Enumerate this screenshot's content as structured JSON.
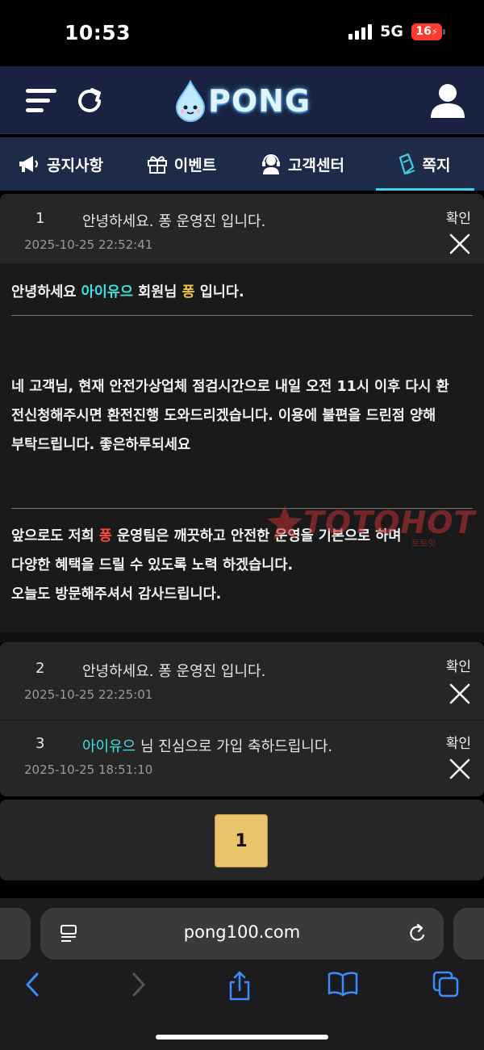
{
  "status_bar": {
    "time": "10:53",
    "network": "5G",
    "battery": "16"
  },
  "header": {
    "logo_text": "PONG"
  },
  "tabs": [
    {
      "label": "공지사항",
      "icon": "megaphone-icon"
    },
    {
      "label": "이벤트",
      "icon": "gift-icon"
    },
    {
      "label": "고객센터",
      "icon": "headset-icon"
    },
    {
      "label": "쪽지",
      "icon": "note-icon",
      "active": true
    }
  ],
  "messages": [
    {
      "num": "1",
      "title": "안녕하세요. 퐁 운영진 입니다.",
      "date": "2025-10-25 22:52:41",
      "confirm": "확인",
      "expanded": true
    },
    {
      "num": "2",
      "title": "안녕하세요. 퐁 운영진 입니다.",
      "date": "2025-10-25 22:25:01",
      "confirm": "확인"
    },
    {
      "num": "3",
      "title_name": "아이유으",
      "title_rest": " 님 진심으로 가입 축하드립니다.",
      "date": "2025-10-25 18:51:10",
      "confirm": "확인"
    }
  ],
  "body": {
    "greet_pre": "안녕하세요 ",
    "greet_name": "아이유으",
    "greet_mid": " 회원님 ",
    "greet_brand": "퐁",
    "greet_post": " 입니다.",
    "para1_line1": "네 고객님, 현재 안전가상업체 점검시간으로 내일 오전 11시 이후 다시 환",
    "para1_line2": "전신청해주시면 환전진행 도와드리겠습니다. 이용에 불편을 드린점 양해",
    "para1_line3": "부탁드립니다. 좋은하루되세요",
    "para2_pre": "앞으로도 저희 ",
    "para2_brand": "퐁",
    "para2_post": " 운영팀은 깨끗하고 안전한 운영을 기본으로 하며",
    "para2_line2": "다양한 혜택을 드릴 수 있도록 노력 하겠습니다.",
    "para2_line3": "오늘도 방문해주셔서 감사드립니다.",
    "watermark": "TOTOHOT",
    "watermark_sub": "토토핫"
  },
  "pagination": {
    "current": "1"
  },
  "browser": {
    "url": "pong100.com"
  },
  "colors": {
    "accent_cyan": "#3fe0e0",
    "brand_yellow": "#f2c33c",
    "brand_red": "#ff4a3a",
    "page_gold": "#eac46a"
  }
}
